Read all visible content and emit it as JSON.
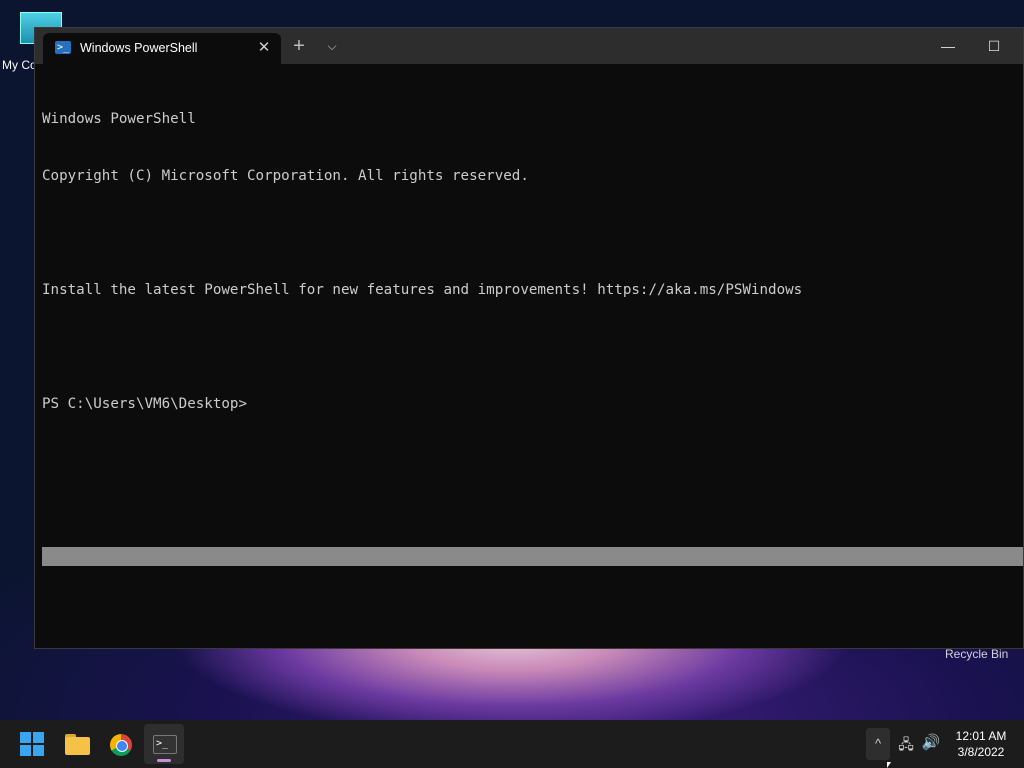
{
  "desktop": {
    "icons": [
      {
        "label": "My Co"
      },
      {
        "label": "Recycle Bin"
      }
    ]
  },
  "window": {
    "tab_title": "Windows PowerShell",
    "tab_icon": "powershell-icon",
    "new_tab_glyph": "+",
    "dropdown_glyph": "⌵",
    "close_tab_glyph": "✕",
    "minimize_glyph": "—",
    "maximize_glyph": "☐"
  },
  "terminal": {
    "lines": [
      "Windows PowerShell",
      "Copyright (C) Microsoft Corporation. All rights reserved.",
      "",
      "Install the latest PowerShell for new features and improvements! https://aka.ms/PSWindows",
      "",
      "PS C:\\Users\\VM6\\Desktop>"
    ]
  },
  "taskbar": {
    "apps": [
      {
        "name": "Start",
        "icon": "windows-logo-icon"
      },
      {
        "name": "File Explorer",
        "icon": "folder-icon"
      },
      {
        "name": "Google Chrome",
        "icon": "chrome-icon"
      },
      {
        "name": "Windows Terminal",
        "icon": "terminal-icon"
      }
    ],
    "tray": {
      "chevron_glyph": "^",
      "network_icon": "network-icon",
      "volume_icon": "speaker-icon"
    },
    "clock": {
      "time": "12:01 AM",
      "date": "3/8/2022"
    }
  }
}
